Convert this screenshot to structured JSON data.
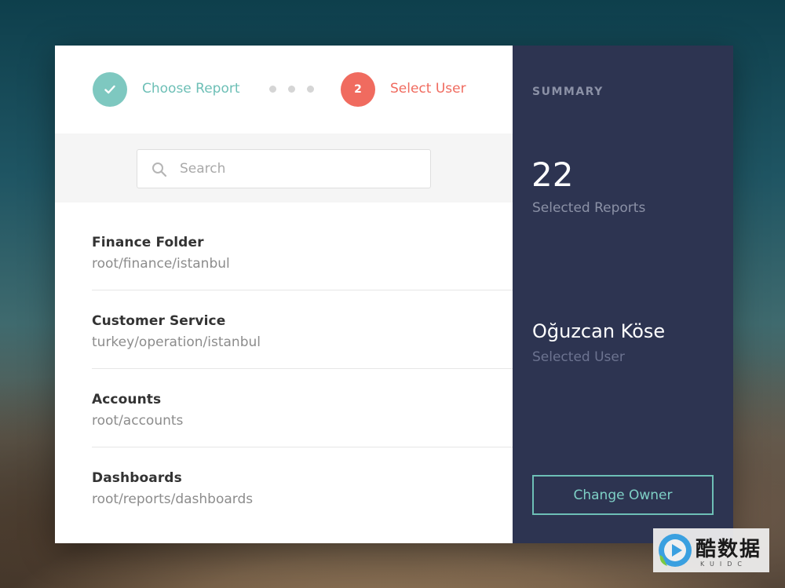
{
  "stepper": {
    "step1": {
      "label": "Choose Report",
      "state": "done"
    },
    "step2": {
      "number": "2",
      "label": "Select User",
      "state": "active"
    }
  },
  "search": {
    "placeholder": "Search",
    "value": ""
  },
  "list": {
    "items": [
      {
        "title": "Finance Folder",
        "path": "root/finance/istanbul"
      },
      {
        "title": "Customer Service",
        "path": "turkey/operation/istanbul"
      },
      {
        "title": "Accounts",
        "path": "root/accounts"
      },
      {
        "title": "Dashboards",
        "path": "root/reports/dashboards"
      }
    ]
  },
  "summary": {
    "heading": "SUMMARY",
    "count": "22",
    "count_label": "Selected Reports",
    "user_name": "Oğuzcan Köse",
    "user_label": "Selected User",
    "button_label": "Change Owner"
  },
  "watermark": {
    "text": "酷数据",
    "sub": "KUIDC"
  },
  "colors": {
    "accent_teal": "#6dbfb6",
    "accent_red": "#f06b5f",
    "panel_navy": "#2d3451"
  },
  "icons": {
    "step1": "checkmark-icon",
    "search": "search-icon"
  }
}
